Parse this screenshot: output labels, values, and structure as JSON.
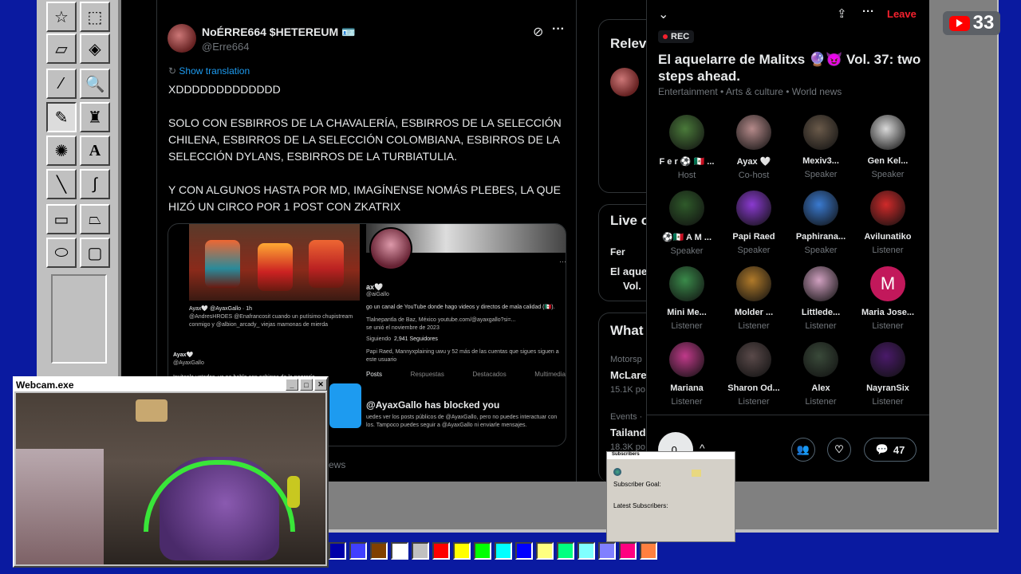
{
  "tweet": {
    "author_name": "NoÉRRE664 $HETEREUM 🪪",
    "author_handle": "@Erre664",
    "show_translation": "Show translation",
    "text": "XDDDDDDDDDDDDD\n\nSOLO CON ESBIRROS DE LA CHAVALERÍA, ESBIRROS DE LA SELECCIÓN CHILENA, ESBIRROS DE LA SELECCIÓN COLOMBIANA, ESBIRROS DE LA SELECCIÓN DYLANS, ESBIRROS DE LA TURBIATULIA.\n\nY CON ALGUNOS HASTA POR MD, IMAGÍNENSE NOMÁS PLEBES, LA QUE HIZÓ UN CIRCO POR 1 POST CON ZKATRIX",
    "embed": {
      "left_reply_author": "Ayax🤍 @AyaxGallo · 1h",
      "left_reply_text": "@AndresHROES @Enafrancosit cuando un putísimo chupistream conmigo y @albion_arcady_ viejas mamonas de mierda",
      "left_reply2_author": "Ayax🤍",
      "left_reply2_handle": "@AyaxGallo",
      "left_reply2_text": "Invitenla ustedes, yo no hablo con esbirros de la negrería",
      "profile_name": "ax🤍",
      "profile_handle": "@aiGallo",
      "profile_bio": "go un canal de YouTube donde hago videos y directos de mala calidad (🇲🇽).",
      "profile_loc": "Tlalnepantla de Baz, México   youtube.com/@ayaxgallo?si=...",
      "profile_joined": "se unió el noviembre de 2023",
      "following_label": "Siguiendo",
      "followers": "2,941 Seguidores",
      "followed_by": "Papi Raed, Mannyxplaining uwu y 52 más de las cuentas que sigues siguen a este usuario",
      "tabs": [
        "Posts",
        "Respuestas",
        "Destacados",
        "Multimedia"
      ],
      "blocked_title": "@AyaxGallo has blocked you",
      "blocked_text": "uedes ver los posts públicos de @AyaxGallo, pero no puedes interactuar con los. Tampoco puedes seguir a @AyaxGallo ni enviarle mensajes."
    },
    "news_label": "ews"
  },
  "middle": {
    "relevant": "Relev",
    "live": "Live o",
    "live_user": "Fer",
    "live_title_1": "El aquel",
    "live_title_2": "Vol.",
    "whats": "What",
    "motorsport": "Motorsp",
    "mclaren": "McLare",
    "mclaren_count": "15.1K po",
    "events": "Events ·",
    "tailand": "Tailand",
    "tailand_count": "18.3K po"
  },
  "space": {
    "leave": "Leave",
    "rec_label": "REC",
    "title": "El aquelarre de Malitxs 🔮😈 Vol. 37: two steps ahead.",
    "topics": "Entertainment • Arts & culture • World news",
    "participants": [
      {
        "name": "F e r ⚽ 🇲🇽 ...",
        "role": "Host",
        "color": "#4a7a3a"
      },
      {
        "name": "Ayax 🤍",
        "role": "Co-host",
        "color": "#b58a8a"
      },
      {
        "name": "Mexiv3...",
        "role": "Speaker",
        "color": "#6a5a4a"
      },
      {
        "name": "Gen Kel...",
        "role": "Speaker",
        "color": "#d9d9d9"
      },
      {
        "name": "⚽🇲🇽 A M ...",
        "role": "Speaker",
        "color": "#2f5a2a"
      },
      {
        "name": "Papi Raed",
        "role": "Speaker",
        "color": "#8a3ad0"
      },
      {
        "name": "Paphirana...",
        "role": "Speaker",
        "color": "#3a7ad0"
      },
      {
        "name": "Avilunatiko",
        "role": "Listener",
        "color": "#d02a2a"
      },
      {
        "name": "Mini Me...",
        "role": "Listener",
        "color": "#3a8a4a"
      },
      {
        "name": "Molder ...",
        "role": "Listener",
        "color": "#b07a2a"
      },
      {
        "name": "Littlede...",
        "role": "Listener",
        "color": "#d0a0c0"
      },
      {
        "name": "Maria Jose...",
        "role": "Listener",
        "color": "#c2185b"
      },
      {
        "name": "Mariana",
        "role": "Listener",
        "color": "#c03a8a"
      },
      {
        "name": "Sharon Od...",
        "role": "Listener",
        "color": "#5a4a4a"
      },
      {
        "name": "Alex",
        "role": "Listener",
        "color": "#3a4a3a"
      },
      {
        "name": "NayranSix",
        "role": "Listener",
        "color": "#4a1a6a"
      }
    ],
    "maria_initial": "M",
    "reply_count": "47",
    "mic_label": "0."
  },
  "webcam": {
    "title": "Webcam.exe"
  },
  "subscribers": {
    "title": "Subscribers",
    "goal_label": "Subscriber Goal:",
    "latest_label": "Latest Subscribers:"
  },
  "youtube": {
    "count": "33"
  },
  "palette": [
    "#0000a8",
    "#4040ff",
    "#804000",
    "#ffffff",
    "#c0c0c0",
    "#ff0000",
    "#ffff00",
    "#00ff00",
    "#00ffff",
    "#0000ff",
    "#ffff80",
    "#00ff80",
    "#80ffff",
    "#8080ff",
    "#ff0080",
    "#ff8040"
  ]
}
